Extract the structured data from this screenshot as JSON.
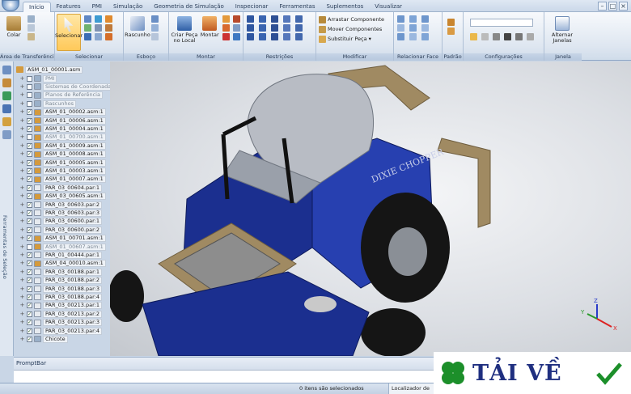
{
  "tabs": [
    "Início",
    "Features",
    "PMI",
    "Simulação",
    "Geometria de Simulação",
    "Inspecionar",
    "Ferramentas",
    "Suplementos",
    "Visualizar"
  ],
  "active_tab": "Início",
  "ribbon": {
    "groups": {
      "clipboard": {
        "label": "Área de Transferência",
        "paste": "Colar"
      },
      "select": {
        "label": "Selecionar",
        "select_btn": "Selecionar"
      },
      "sketch": {
        "label": "Esboço",
        "draft_btn": "Rascunho"
      },
      "assemble": {
        "label": "Montar",
        "create_part": "Criar Peça no Local",
        "assemble_btn": "Montar"
      },
      "relations": {
        "label": "Restrições"
      },
      "modify": {
        "label": "Modificar",
        "drag": "Arrastar Componente",
        "move": "Mover Componentes",
        "replace": "Substituir Peça"
      },
      "relate_face": {
        "label": "Relacionar Face"
      },
      "pattern": {
        "label": "Padrão"
      },
      "config": {
        "label": "Configurações"
      },
      "window": {
        "label": "Janela",
        "switch": "Alternar Janelas"
      }
    }
  },
  "rail": {
    "label": "Ferramentas de Seleção"
  },
  "tree": {
    "root": "ASM_01_00001.asm",
    "nodes": [
      {
        "label": "PMI",
        "dim": true,
        "checked": false
      },
      {
        "label": "Sistemas de Coordenadas",
        "dim": true,
        "checked": false
      },
      {
        "label": "Planos de Referência",
        "dim": true,
        "checked": false
      },
      {
        "label": "Rascunhos",
        "dim": true,
        "checked": false
      },
      {
        "label": "ASM_01_00002.asm:1",
        "dim": false,
        "checked": true
      },
      {
        "label": "ASM_01_00006.asm:1",
        "dim": false,
        "checked": true
      },
      {
        "label": "ASM_01_00004.asm:1",
        "dim": false,
        "checked": true
      },
      {
        "label": "ASM_01_00700.asm:1",
        "dim": true,
        "checked": false
      },
      {
        "label": "ASM_01_00009.asm:1",
        "dim": false,
        "checked": true
      },
      {
        "label": "ASM_01_00008.asm:1",
        "dim": false,
        "checked": true
      },
      {
        "label": "ASM_01_00005.asm:1",
        "dim": false,
        "checked": true
      },
      {
        "label": "ASM_01_00003.asm:1",
        "dim": false,
        "checked": true
      },
      {
        "label": "ASM_01_00007.asm:1",
        "dim": false,
        "checked": true
      },
      {
        "label": "PAR_03_00604.par:1",
        "dim": false,
        "checked": true
      },
      {
        "label": "ASM_03_00605.asm:1",
        "dim": false,
        "checked": true
      },
      {
        "label": "PAR_03_00603.par:2",
        "dim": false,
        "checked": true
      },
      {
        "label": "PAR_03_00603.par:3",
        "dim": false,
        "checked": true
      },
      {
        "label": "PAR_03_00600.par:1",
        "dim": false,
        "checked": true
      },
      {
        "label": "PAR_03_00600.par:2",
        "dim": false,
        "checked": true
      },
      {
        "label": "ASM_01_00701.asm:1",
        "dim": false,
        "checked": true
      },
      {
        "label": "ASM_01_00607.asm:1",
        "dim": true,
        "checked": false
      },
      {
        "label": "PAR_01_00444.par:1",
        "dim": false,
        "checked": true
      },
      {
        "label": "ASM_04_00010.asm:1",
        "dim": false,
        "checked": true
      },
      {
        "label": "PAR_03_00188.par:1",
        "dim": false,
        "checked": true
      },
      {
        "label": "PAR_03_00188.par:2",
        "dim": false,
        "checked": true
      },
      {
        "label": "PAR_03_00188.par:3",
        "dim": false,
        "checked": true
      },
      {
        "label": "PAR_03_00188.par:4",
        "dim": false,
        "checked": true
      },
      {
        "label": "PAR_03_00213.par:1",
        "dim": false,
        "checked": true
      },
      {
        "label": "PAR_03_00213.par:2",
        "dim": false,
        "checked": true
      },
      {
        "label": "PAR_03_00213.par:3",
        "dim": false,
        "checked": true
      },
      {
        "label": "PAR_03_00213.par:4",
        "dim": false,
        "checked": true
      },
      {
        "label": "Chicote",
        "dim": false,
        "checked": true
      }
    ]
  },
  "viewport": {
    "decal": "DIXIE CHOPPER",
    "triad": {
      "x": "X",
      "y": "Y",
      "z": "Z"
    }
  },
  "prompt_bar": "PromptBar",
  "status": {
    "selected": "0 itens são selecionados",
    "locator": "Localizador de Comando"
  },
  "watermark": {
    "text": "TẢI VỀ"
  },
  "colors": {
    "accent_blue": "#1b2f8f",
    "chassis": "#a08a62",
    "seat": "#b8bcc4",
    "select_btn": "#ffc95a"
  }
}
